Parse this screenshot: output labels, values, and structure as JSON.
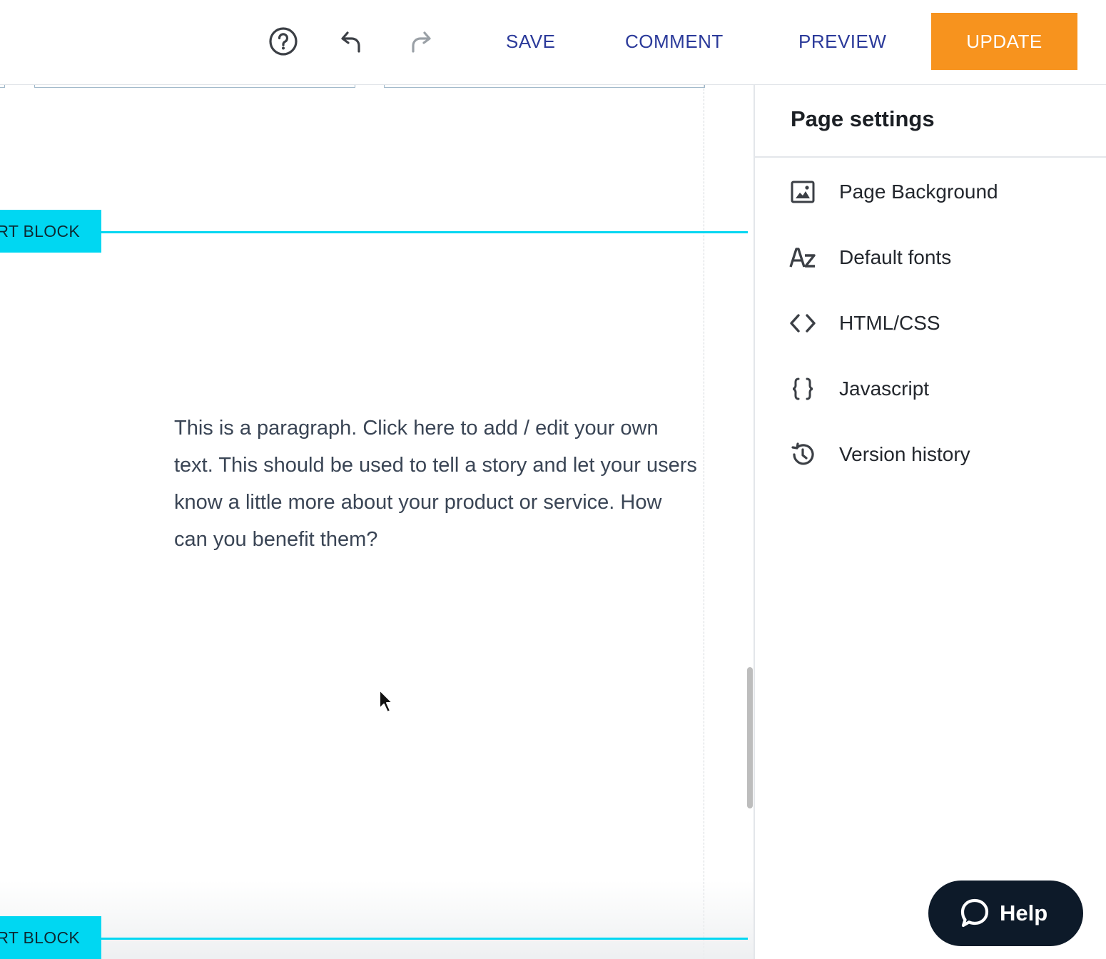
{
  "toolbar": {
    "save_label": "SAVE",
    "comment_label": "COMMENT",
    "preview_label": "PREVIEW",
    "update_label": "UPDATE",
    "icons": [
      "help-circle-icon",
      "undo-icon",
      "redo-icon"
    ]
  },
  "canvas": {
    "insert_block_label_top": "RT BLOCK",
    "insert_block_label_bottom": "RT BLOCK",
    "paragraph": "This is a paragraph. Click here to add / edit your own text. This should be used to tell a story and let your users know a little more about your product or service. How can you benefit them?"
  },
  "panel": {
    "title": "Page settings",
    "items": [
      {
        "label": "Page Background",
        "icon": "image-icon"
      },
      {
        "label": "Default fonts",
        "icon": "font-az-icon"
      },
      {
        "label": "HTML/CSS",
        "icon": "code-brackets-icon"
      },
      {
        "label": "Javascript",
        "icon": "curly-braces-icon"
      },
      {
        "label": "Version history",
        "icon": "history-icon"
      }
    ]
  },
  "help": {
    "label": "Help"
  },
  "colors": {
    "accent_orange": "#f7931e",
    "link_blue": "#2b3a9a",
    "insert_cyan": "#00d7f2",
    "help_dark": "#0d1a29"
  }
}
